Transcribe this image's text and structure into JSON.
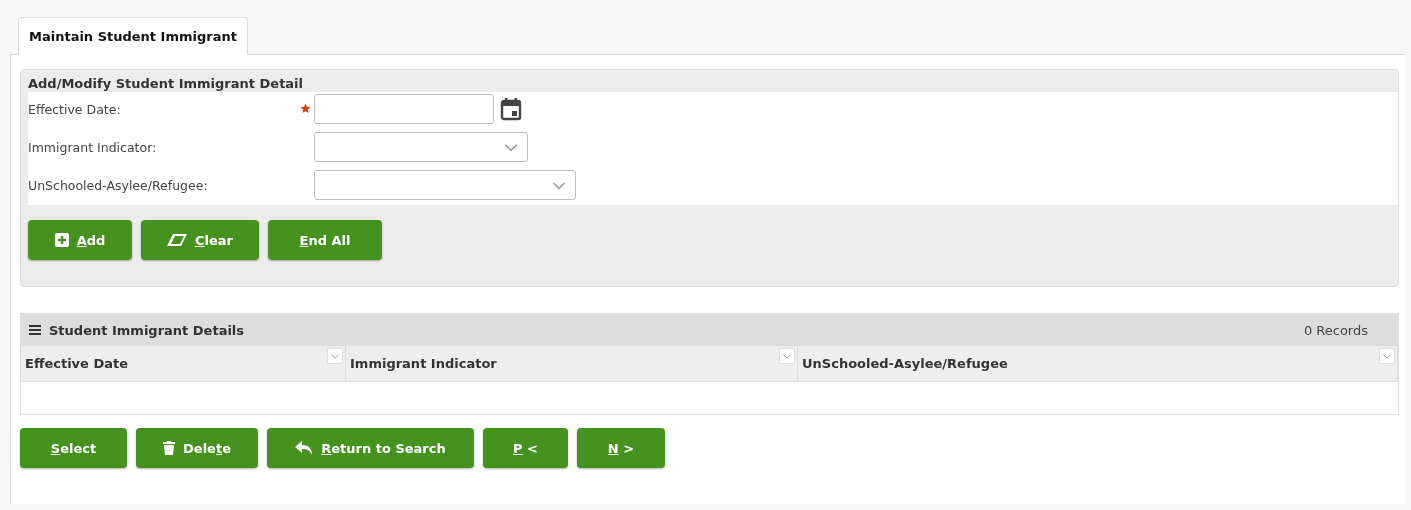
{
  "tabs": [
    {
      "label": "Maintain Student Immigrant",
      "selected": true
    }
  ],
  "detail": {
    "title": "Add/Modify Student Immigrant Detail",
    "fields": [
      {
        "kind": "date",
        "label": "Effective Date:",
        "required": true
      },
      {
        "kind": "select",
        "label": "Immigrant Indicator:",
        "required": false
      },
      {
        "kind": "select",
        "label": "UnSchooled-Asylee/Refugee:",
        "required": false,
        "wide": true
      }
    ],
    "buttons": [
      {
        "key": "A",
        "post": "dd"
      },
      {
        "key": "C",
        "post": "lear"
      },
      {
        "key": "E",
        "post": "nd All"
      }
    ]
  },
  "grid": {
    "title": "Student Immigrant Details",
    "count": "0 Records",
    "columns": [
      "Effective Date",
      "Immigrant Indicator",
      "UnSchooled-Asylee/Refugee"
    ]
  },
  "buttons": [
    {
      "key": "S",
      "post": "elect"
    },
    {
      "pre": "Dele",
      "key": "t",
      "post": "e"
    },
    {
      "key": "R",
      "post": "eturn to Search"
    },
    {
      "key": "P",
      "post": " <"
    },
    {
      "key": "N",
      "post": " >"
    }
  ]
}
